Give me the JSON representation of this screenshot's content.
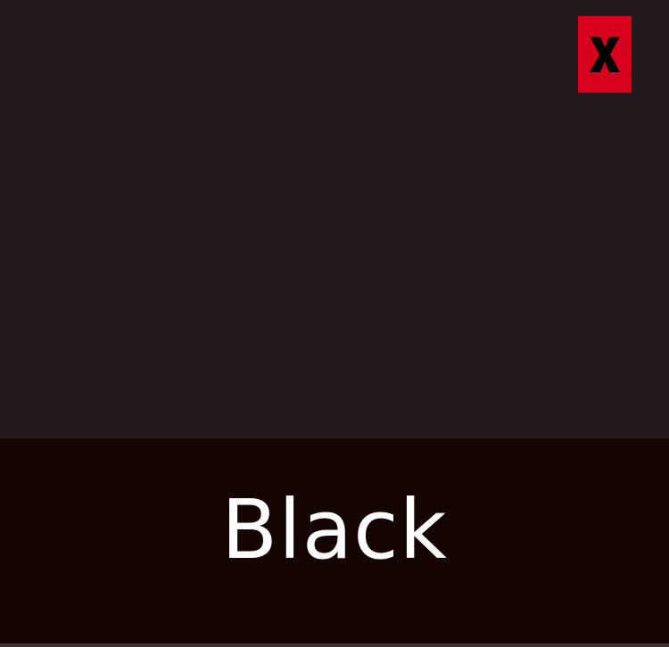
{
  "color_name": "Black",
  "close_button": {
    "label": "X",
    "icon": "close-icon"
  },
  "colors": {
    "swatch": "#231a1b",
    "label_bar": "#140502",
    "label_text": "#ffffff",
    "close_background": "#d6001c",
    "close_glyph": "#000000"
  }
}
